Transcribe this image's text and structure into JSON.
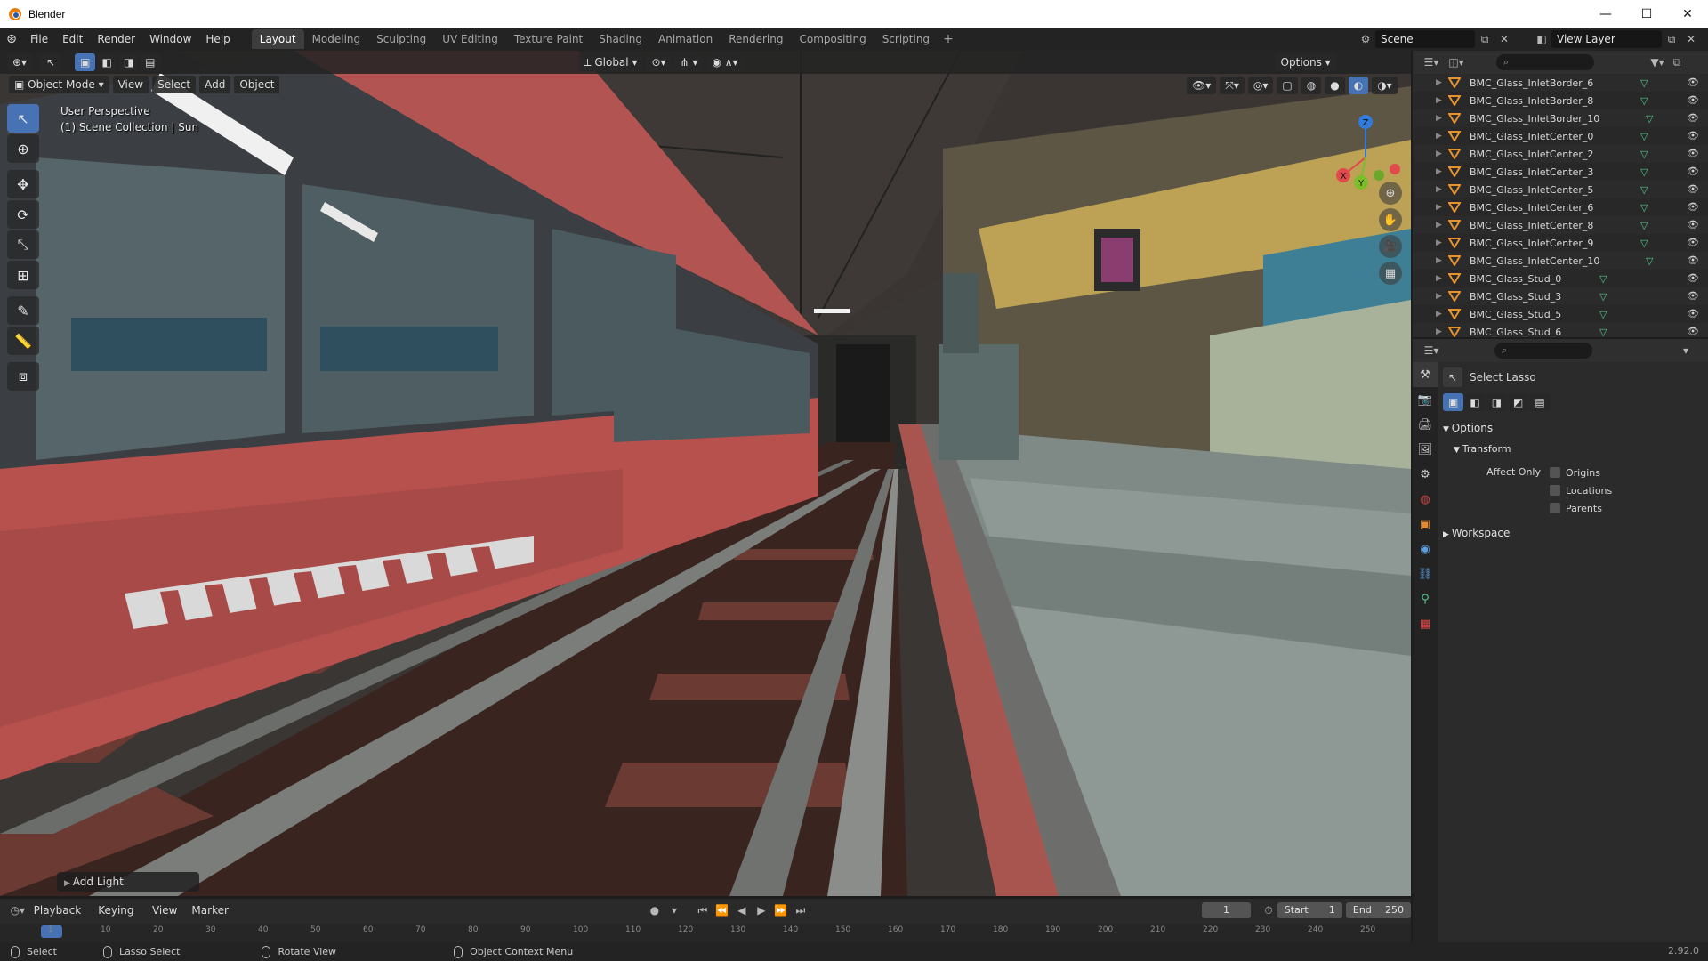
{
  "window": {
    "title": "Blender",
    "controls": [
      "—",
      "☐",
      "✕"
    ]
  },
  "menubar": {
    "items": [
      "File",
      "Edit",
      "Render",
      "Window",
      "Help"
    ],
    "workspaces": [
      "Layout",
      "Modeling",
      "Sculpting",
      "UV Editing",
      "Texture Paint",
      "Shading",
      "Animation",
      "Rendering",
      "Compositing",
      "Scripting"
    ],
    "active_workspace": "Layout",
    "add_tab": "+",
    "scene": "Scene",
    "view_layer": "View Layer"
  },
  "viewport": {
    "mode": "Object Mode",
    "menus": [
      "View",
      "Select",
      "Add",
      "Object"
    ],
    "orientation": "Global",
    "options_label": "Options",
    "perspective_label": "User Perspective",
    "collection_label": "(1) Scene Collection | Sun",
    "last_operator": "Add Light",
    "gizmo_axes": {
      "x": "X",
      "y": "Y",
      "z": "Z"
    },
    "colors": {
      "train_red": "#b7514e",
      "train_dark": "#3b3e43",
      "rail": "#5c5f5e",
      "sleeper": "#6a3a33",
      "platform": "#7e8a86"
    }
  },
  "outliner": {
    "search_placeholder": "",
    "rows": [
      "BMC_Glass_InletBorder_6",
      "BMC_Glass_InletBorder_8",
      "BMC_Glass_InletBorder_10",
      "BMC_Glass_InletCenter_0",
      "BMC_Glass_InletCenter_2",
      "BMC_Glass_InletCenter_3",
      "BMC_Glass_InletCenter_5",
      "BMC_Glass_InletCenter_6",
      "BMC_Glass_InletCenter_8",
      "BMC_Glass_InletCenter_9",
      "BMC_Glass_InletCenter_10",
      "BMC_Glass_Stud_0",
      "BMC_Glass_Stud_3",
      "BMC_Glass_Stud_5",
      "BMC_Glass_Stud_6"
    ]
  },
  "properties": {
    "tool_name": "Select Lasso",
    "options_header": "Options",
    "transform_header": "Transform",
    "affect_only_label": "Affect Only",
    "checkboxes": [
      "Origins",
      "Locations",
      "Parents"
    ],
    "workspace_header": "Workspace"
  },
  "timeline": {
    "menus": [
      "Playback",
      "Keying",
      "View",
      "Marker"
    ],
    "current_frame": "1",
    "start_label": "Start",
    "start_value": "1",
    "end_label": "End",
    "end_value": "250",
    "ruler_ticks": [
      "1",
      "10",
      "20",
      "30",
      "40",
      "50",
      "60",
      "70",
      "80",
      "90",
      "100",
      "110",
      "120",
      "130",
      "140",
      "150",
      "160",
      "170",
      "180",
      "190",
      "200",
      "210",
      "220",
      "230",
      "240",
      "250"
    ]
  },
  "statusbar": {
    "items": [
      "Select",
      "Lasso Select",
      "Rotate View",
      "Object Context Menu"
    ],
    "version": "2.92.0"
  }
}
